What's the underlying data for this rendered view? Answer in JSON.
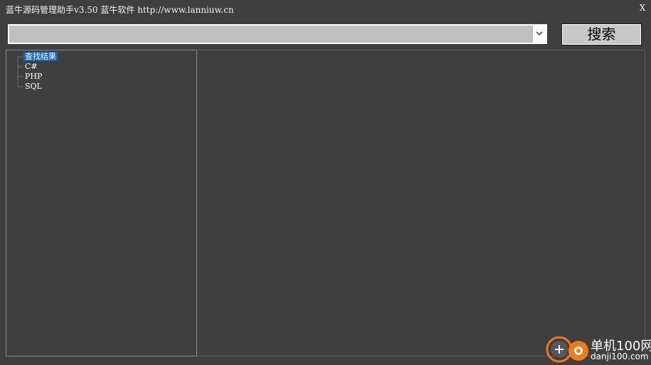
{
  "window": {
    "title": "蓝牛源码管理助手v3.50  蓝牛软件  http://www.lanniuw.cn",
    "close_label": "X"
  },
  "search": {
    "value": "",
    "placeholder": "",
    "button_label": "搜索"
  },
  "tree": {
    "nodes": [
      {
        "label": "查找结果",
        "selected": true
      },
      {
        "label": "C#",
        "selected": false
      },
      {
        "label": "PHP",
        "selected": false
      },
      {
        "label": "SQL",
        "selected": false
      }
    ]
  },
  "watermark": {
    "name": "单机100网",
    "url": "danji100.com"
  },
  "colors": {
    "background": "#3f3f3f",
    "selection": "#1366c4",
    "input_bg": "#bfbfbf",
    "button_bg": "#c8c8c8",
    "watermark_accent": "#f07a1a"
  }
}
